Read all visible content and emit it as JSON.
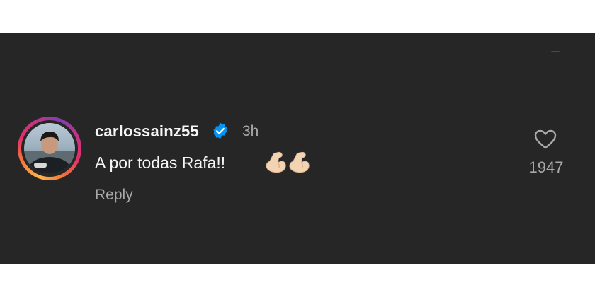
{
  "comment": {
    "username": "carlossainz55",
    "time": "3h",
    "text": "A por todas Rafa!!",
    "reply_label": "Reply",
    "like_count": "1947",
    "emoji": "flexed-biceps"
  },
  "colors": {
    "background": "#262626",
    "primary_text": "#f5f5f5",
    "secondary_text": "#a8a8a8",
    "verified_badge": "#0095f6"
  },
  "icons": {
    "verified": "verified-badge-icon",
    "like": "heart-icon"
  }
}
